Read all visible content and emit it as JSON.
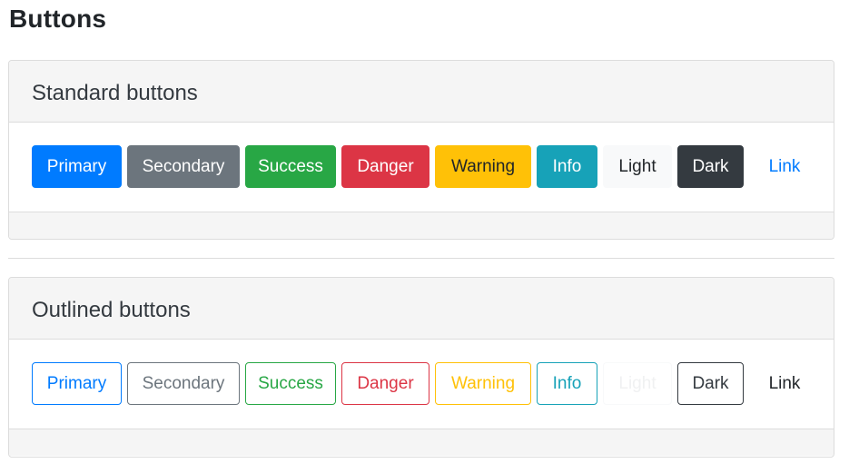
{
  "page": {
    "title": "Buttons"
  },
  "standard": {
    "title": "Standard buttons",
    "buttons": [
      {
        "label": "Primary",
        "variant": "primary",
        "color": "#007bff"
      },
      {
        "label": "Secondary",
        "variant": "secondary",
        "color": "#6c757d"
      },
      {
        "label": "Success",
        "variant": "success",
        "color": "#28a745"
      },
      {
        "label": "Danger",
        "variant": "danger",
        "color": "#dc3545"
      },
      {
        "label": "Warning",
        "variant": "warning",
        "color": "#ffc107"
      },
      {
        "label": "Info",
        "variant": "info",
        "color": "#17a2b8"
      },
      {
        "label": "Light",
        "variant": "light",
        "color": "#f8f9fa"
      },
      {
        "label": "Dark",
        "variant": "dark",
        "color": "#343a40"
      },
      {
        "label": "Link",
        "variant": "link",
        "color": "#007bff"
      }
    ]
  },
  "outlined": {
    "title": "Outlined buttons",
    "buttons": [
      {
        "label": "Primary",
        "variant": "outline-primary",
        "color": "#007bff"
      },
      {
        "label": "Secondary",
        "variant": "outline-secondary",
        "color": "#6c757d"
      },
      {
        "label": "Success",
        "variant": "outline-success",
        "color": "#28a745"
      },
      {
        "label": "Danger",
        "variant": "outline-danger",
        "color": "#dc3545"
      },
      {
        "label": "Warning",
        "variant": "outline-warning",
        "color": "#ffc107"
      },
      {
        "label": "Info",
        "variant": "outline-info",
        "color": "#17a2b8"
      },
      {
        "label": "Light",
        "variant": "outline-light",
        "color": "#f8f9fa"
      },
      {
        "label": "Dark",
        "variant": "outline-dark",
        "color": "#343a40"
      },
      {
        "label": "Link",
        "variant": "outline-link",
        "color": "#212529"
      }
    ]
  }
}
